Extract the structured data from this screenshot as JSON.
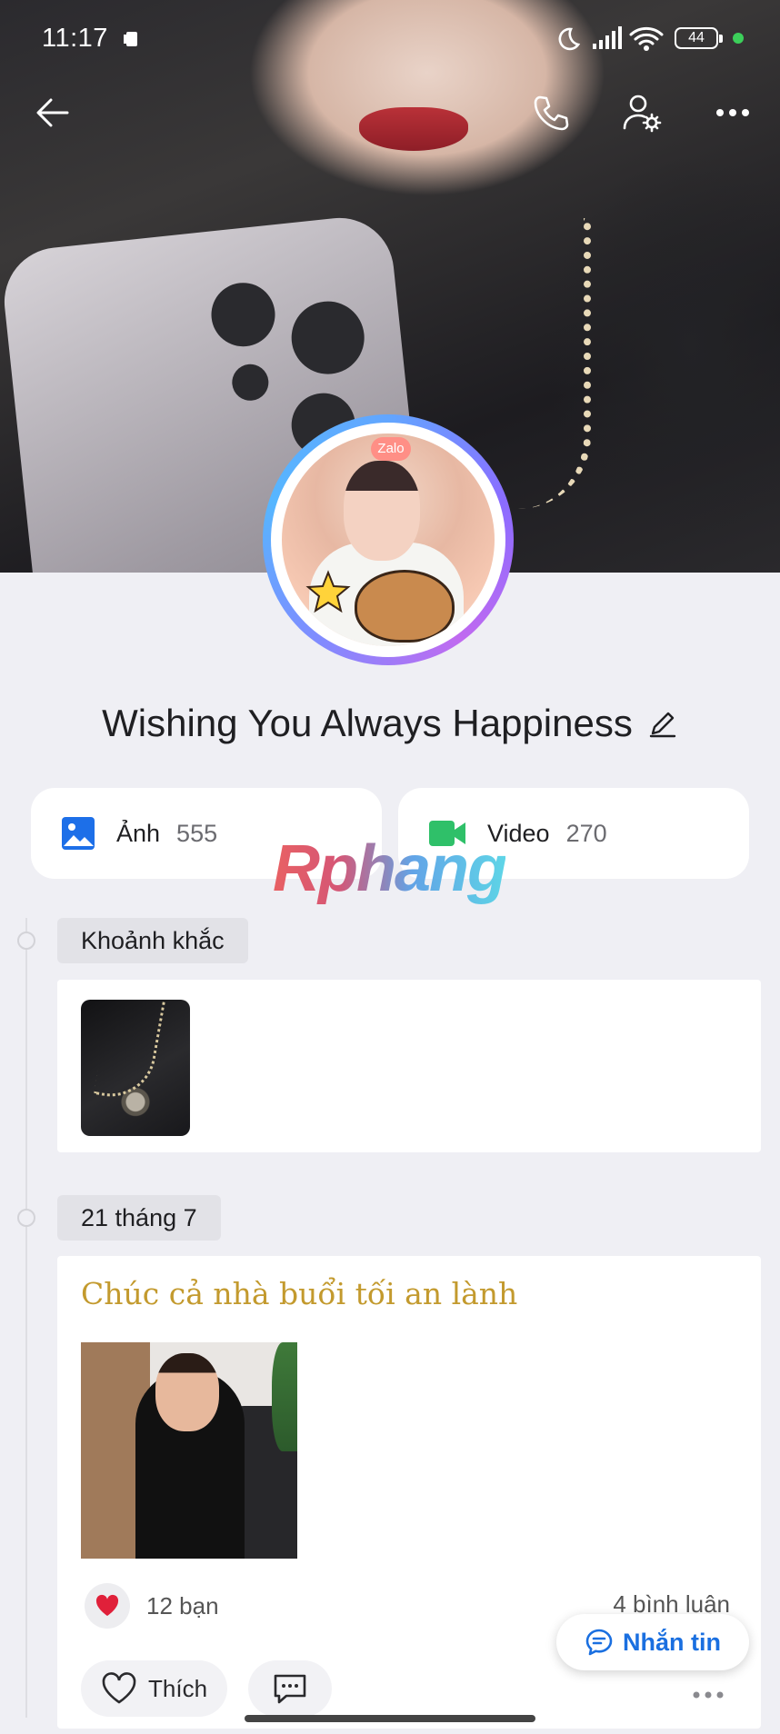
{
  "status_bar": {
    "time": "11:17",
    "battery": "44",
    "icons": [
      "sim-card-icon",
      "moon-icon",
      "signal-icon",
      "wifi-icon",
      "battery-icon"
    ]
  },
  "profile": {
    "name": "Wishing You Always Happiness",
    "badge": "Zalo"
  },
  "media": {
    "photos": {
      "label": "Ảnh",
      "count": "555"
    },
    "videos": {
      "label": "Video",
      "count": "270"
    }
  },
  "watermark": "Rphang",
  "timeline": {
    "moments_label": "Khoảnh khắc",
    "post_date": "21 tháng 7",
    "post": {
      "title": "Chúc cả nhà buổi tối an lành",
      "reactions": "12 bạn",
      "comments": "4 bình luận",
      "like_label": "Thích"
    }
  },
  "actions": {
    "message_label": "Nhắn tin"
  },
  "colors": {
    "accent": "#1a6fe0",
    "post_title": "#c39a2e",
    "photo_icon": "#1d6fe8",
    "video_icon": "#2fc069",
    "heart": "#e0203a"
  }
}
